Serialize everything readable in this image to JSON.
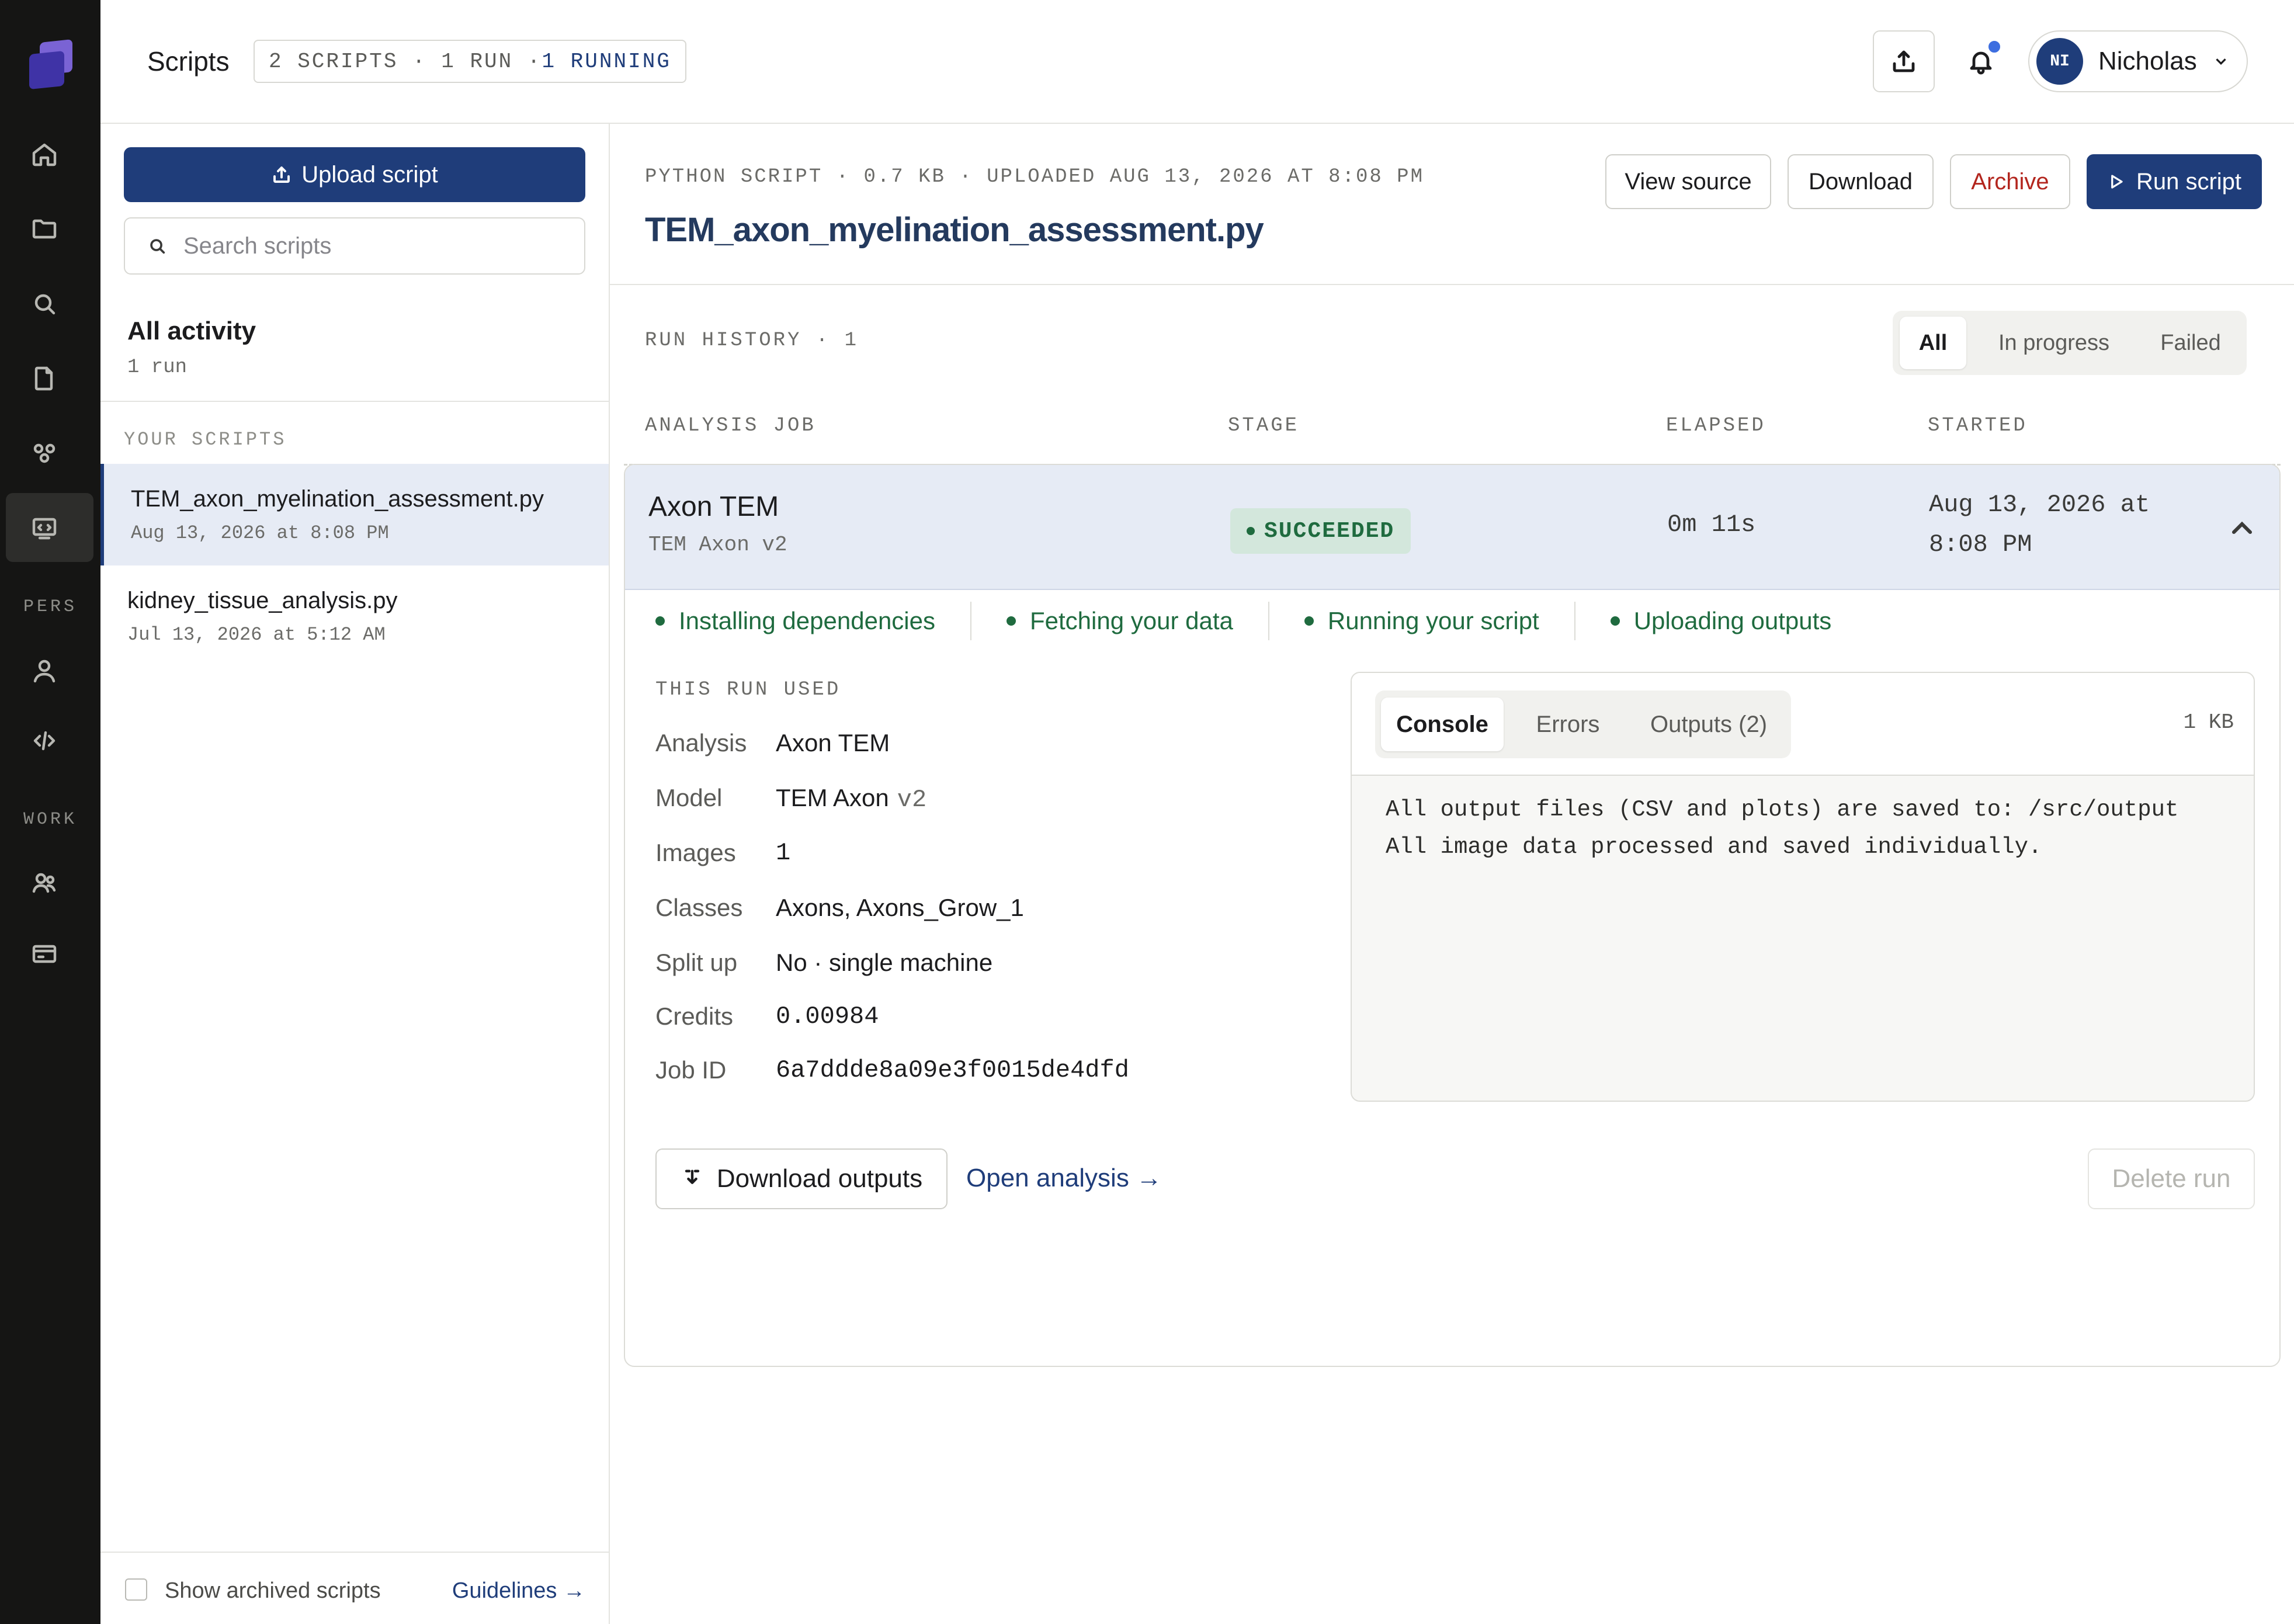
{
  "rail": {
    "section_personal": "PERS",
    "section_work": "WORK"
  },
  "topbar": {
    "title": "Scripts",
    "chip_prefix": "2 SCRIPTS · 1 RUN · ",
    "chip_running": "1 RUNNING",
    "user_initials": "NI",
    "user_name": "Nicholas"
  },
  "sidebar": {
    "upload_label": "Upload script",
    "search_placeholder": "Search scripts",
    "all_activity": "All activity",
    "all_activity_sub": "1 run",
    "section_label": "YOUR SCRIPTS",
    "scripts": [
      {
        "name": "TEM_axon_myelination_assessment.py",
        "date": "Aug 13, 2026 at 8:08 PM",
        "active": true
      },
      {
        "name": "kidney_tissue_analysis.py",
        "date": "Jul 13, 2026 at 5:12 AM",
        "active": false
      }
    ],
    "show_archived": "Show archived scripts",
    "guidelines": "Guidelines →"
  },
  "main": {
    "meta": "PYTHON SCRIPT · 0.7 KB · UPLOADED AUG 13, 2026 AT 8:08 PM",
    "title": "TEM_axon_myelination_assessment.py",
    "buttons": {
      "view_source": "View source",
      "download": "Download",
      "archive": "Archive",
      "run": "Run script"
    },
    "history_label": "RUN HISTORY · 1",
    "filters": {
      "all": "All",
      "in_progress": "In progress",
      "failed": "Failed"
    },
    "columns": {
      "job": "ANALYSIS JOB",
      "stage": "STAGE",
      "elapsed": "ELAPSED",
      "started": "STARTED"
    }
  },
  "run": {
    "job_name": "Axon TEM",
    "job_sub": "TEM Axon v2",
    "stage": "SUCCEEDED",
    "elapsed": "0m 11s",
    "started": "Aug 13, 2026 at 8:08 PM",
    "steps": [
      "Installing dependencies",
      "Fetching your data",
      "Running your script",
      "Uploading outputs"
    ],
    "used_title": "THIS RUN USED",
    "details": {
      "analysis_key": "Analysis",
      "analysis_val": "Axon TEM",
      "model_key": "Model",
      "model_val": "TEM Axon",
      "model_ver": "v2",
      "images_key": "Images",
      "images_val": "1",
      "classes_key": "Classes",
      "classes_val": "Axons, Axons_Grow_1",
      "split_key": "Split up",
      "split_val": "No · single machine",
      "credits_key": "Credits",
      "credits_val": "0.00984",
      "jobid_key": "Job ID",
      "jobid_val": "6a7ddde8a09e3f0015de4dfd"
    },
    "console": {
      "tabs": {
        "console": "Console",
        "errors": "Errors",
        "outputs": "Outputs (2)"
      },
      "size": "1 KB",
      "lines": "All output files (CSV and plots) are saved to: /src/output\nAll image data processed and saved individually."
    },
    "download_outputs": "Download outputs",
    "open_analysis": "Open analysis →",
    "delete_run": "Delete run"
  }
}
